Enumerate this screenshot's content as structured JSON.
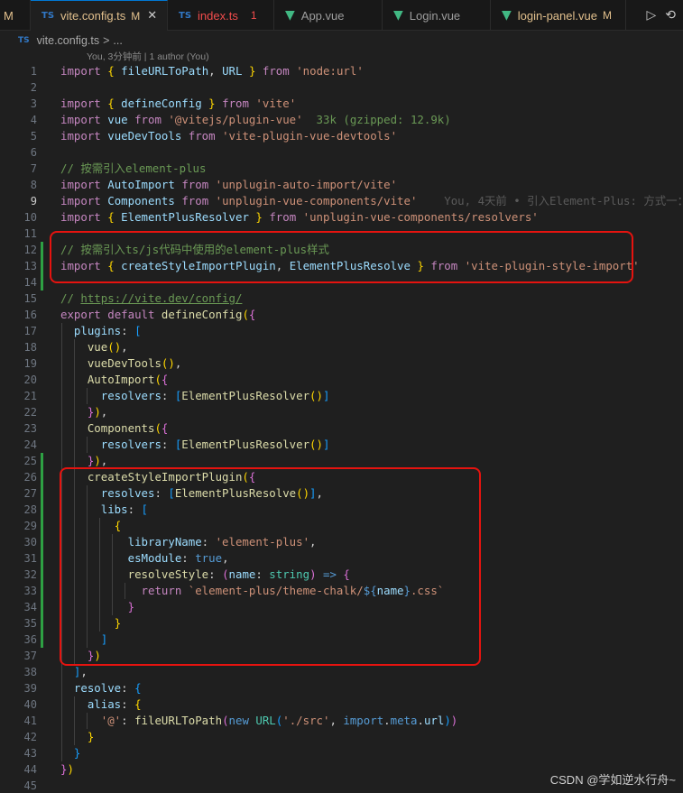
{
  "tabs": [
    {
      "icon": "ts",
      "name": "vite.config.ts",
      "mark": "M",
      "active": true
    },
    {
      "icon": "ts",
      "name": "index.ts",
      "mark": "1",
      "active": false
    },
    {
      "icon": "vue",
      "name": "App.vue",
      "mark": "",
      "active": false
    },
    {
      "icon": "vue",
      "name": "Login.vue",
      "mark": "",
      "active": false
    },
    {
      "icon": "vue",
      "name": "login-panel.vue",
      "mark": "M",
      "active": false
    }
  ],
  "tab_left_stub": "M",
  "breadcrumb": {
    "icon": "TS",
    "file": "vite.config.ts",
    "sep": ">",
    "more": "..."
  },
  "blame_header": "You, 3分钟前 | 1 author (You)",
  "inline_blame": "You, 4天前 • 引入Element-Plus: 方式一：",
  "watermark": "CSDN @学如逆水行舟~",
  "code": {
    "l1": [
      "import",
      "{",
      "fileURLToPath",
      ",",
      "URL",
      "}",
      "from",
      "'node:url'"
    ],
    "l3": [
      "import",
      "{",
      "defineConfig",
      "}",
      "from",
      "'vite'"
    ],
    "l4": [
      "import",
      "vue",
      "from",
      "'@vitejs/plugin-vue'",
      "33k (gzipped: 12.9k)"
    ],
    "l5": [
      "import",
      "vueDevTools",
      "from",
      "'vite-plugin-vue-devtools'"
    ],
    "l7": "// 按需引入element-plus",
    "l8": [
      "import",
      "AutoImport",
      "from",
      "'unplugin-auto-import/vite'"
    ],
    "l9": [
      "import",
      "Components",
      "from",
      "'unplugin-vue-components/vite'"
    ],
    "l10": [
      "import",
      "{",
      "ElementPlusResolver",
      "}",
      "from",
      "'unplugin-vue-components/resolvers'"
    ],
    "l12": "// 按需引入ts/js代码中使用的element-plus样式",
    "l13": [
      "import",
      "{",
      "createStyleImportPlugin",
      ",",
      "ElementPlusResolve",
      "}",
      "from",
      "'vite-plugin-style-import'"
    ],
    "l15_prefix": "// ",
    "l15_url": "https://vite.dev/config/",
    "l16": [
      "export",
      "default",
      "defineConfig",
      "(",
      "{"
    ],
    "l17": "plugins",
    "l18": "vue",
    "l19": "vueDevTools",
    "l20": "AutoImport",
    "l21": [
      "resolvers",
      "ElementPlusResolver"
    ],
    "l23": "Components",
    "l24": [
      "resolvers",
      "ElementPlusResolver"
    ],
    "l26": "createStyleImportPlugin",
    "l27": [
      "resolves",
      "ElementPlusResolve"
    ],
    "l28": "libs",
    "l30": [
      "libraryName",
      "'element-plus'"
    ],
    "l31": [
      "esModule",
      "true"
    ],
    "l32": [
      "resolveStyle",
      "name",
      "string"
    ],
    "l33": [
      "return",
      "`element-plus/theme-chalk/",
      "${",
      "name",
      "}",
      ".css`"
    ],
    "l39": "resolve",
    "l40": "alias",
    "l41": [
      "'@'",
      "fileURLToPath",
      "new",
      "URL",
      "'./src'",
      "import",
      "meta",
      "url"
    ]
  },
  "line_count": 45,
  "current_line": 9
}
